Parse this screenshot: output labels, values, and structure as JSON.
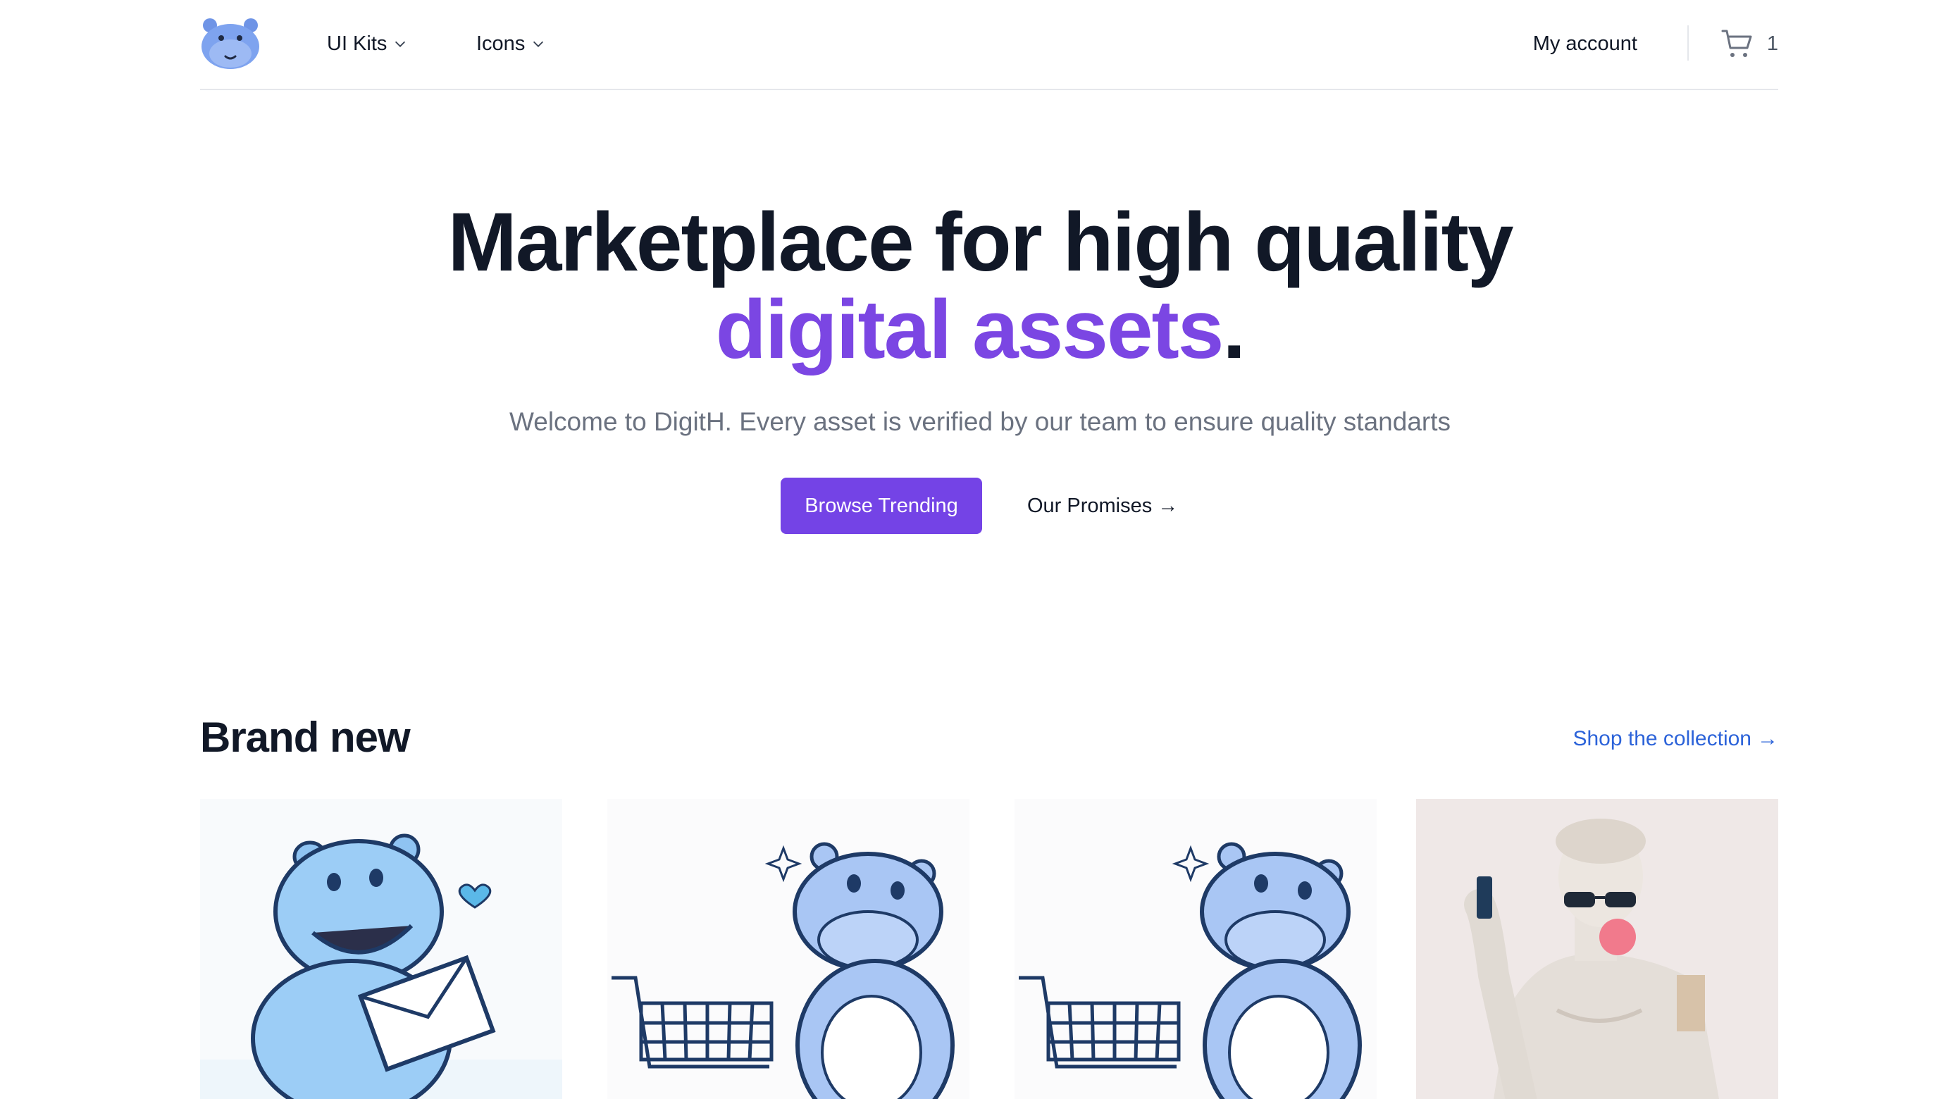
{
  "header": {
    "nav": [
      {
        "label": "UI Kits",
        "icon": "chevron-down-icon"
      },
      {
        "label": "Icons",
        "icon": "chevron-down-icon"
      }
    ],
    "account_label": "My account",
    "cart_count": "1",
    "logo_icon": "hippo-logo-icon",
    "cart_icon": "shopping-cart-icon"
  },
  "hero": {
    "title_line1": "Marketplace for high quality",
    "title_accent": "digital assets",
    "title_period": ".",
    "subtitle": "Welcome to DigitH. Every asset is verified by our team to ensure quality standarts",
    "primary_button": "Browse Trending",
    "secondary_link": "Our Promises",
    "secondary_arrow": "→"
  },
  "brand_new": {
    "title": "Brand new",
    "shop_link": "Shop the collection",
    "shop_arrow": "→"
  },
  "colors": {
    "accent": "#7b46e3",
    "button": "#7443e6",
    "link": "#2c63d9",
    "text": "#111827",
    "muted": "#6b7280"
  }
}
